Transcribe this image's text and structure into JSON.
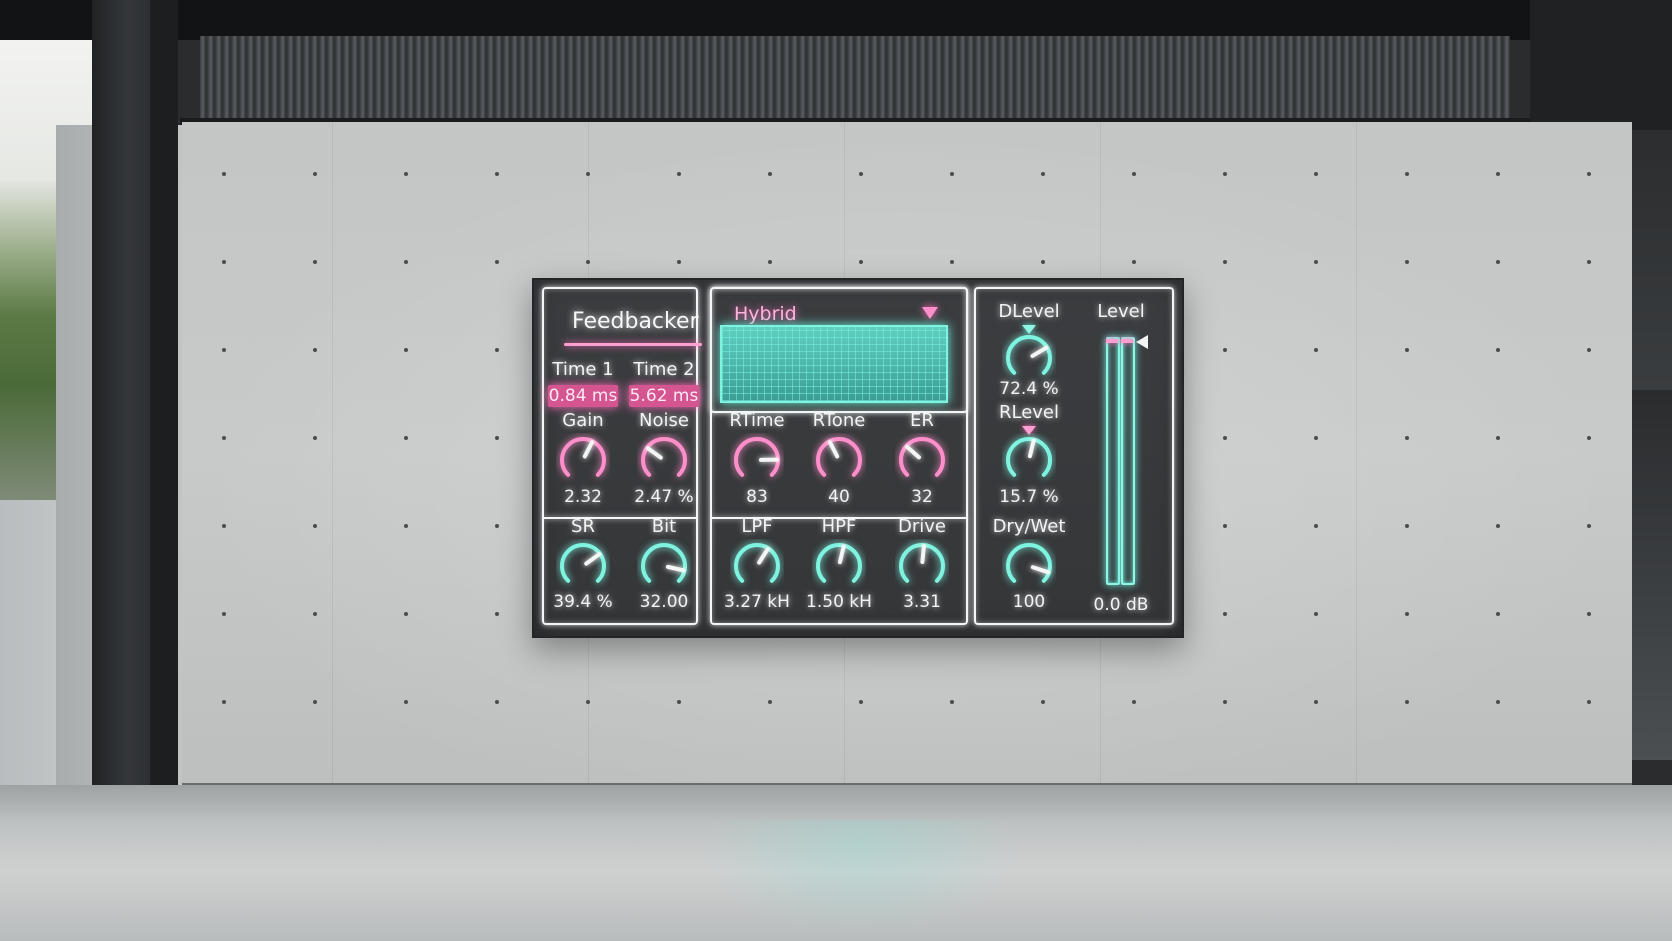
{
  "plugin": {
    "title": "Feedbacker",
    "time1": {
      "label": "Time 1",
      "value": "0.84 ms"
    },
    "time2": {
      "label": "Time 2",
      "value": "5.62 ms"
    },
    "gain": {
      "label": "Gain",
      "value": "2.32",
      "level": 0.6
    },
    "noise": {
      "label": "Noise",
      "value": "2.47 %",
      "level": 0.3
    },
    "sr": {
      "label": "SR",
      "value": "39.4 %",
      "level": 0.7
    },
    "bit": {
      "label": "Bit",
      "value": "32.00",
      "level": 0.88
    },
    "mode": {
      "label": "Hybrid"
    },
    "rtime": {
      "label": "RTime",
      "value": "83",
      "level": 0.83
    },
    "rtone": {
      "label": "RTone",
      "value": "40",
      "level": 0.4
    },
    "er": {
      "label": "ER",
      "value": "32",
      "level": 0.32
    },
    "lpf": {
      "label": "LPF",
      "value": "3.27 kH",
      "level": 0.62
    },
    "hpf": {
      "label": "HPF",
      "value": "1.50 kH",
      "level": 0.55
    },
    "drive": {
      "label": "Drive",
      "value": "3.31",
      "level": 0.52
    },
    "dlevel": {
      "label": "DLevel",
      "value": "72.4 %",
      "level": 0.72
    },
    "rlevel": {
      "label": "RLevel",
      "value": "15.7 %",
      "level": 0.55
    },
    "drywet": {
      "label": "Dry/Wet",
      "value": "100",
      "level": 0.9
    },
    "level": {
      "label": "Level",
      "value": "0.0 dB"
    }
  },
  "colors": {
    "pink": "#ff8fca",
    "teal": "#7ef3e0",
    "white": "#f4f6f6"
  }
}
